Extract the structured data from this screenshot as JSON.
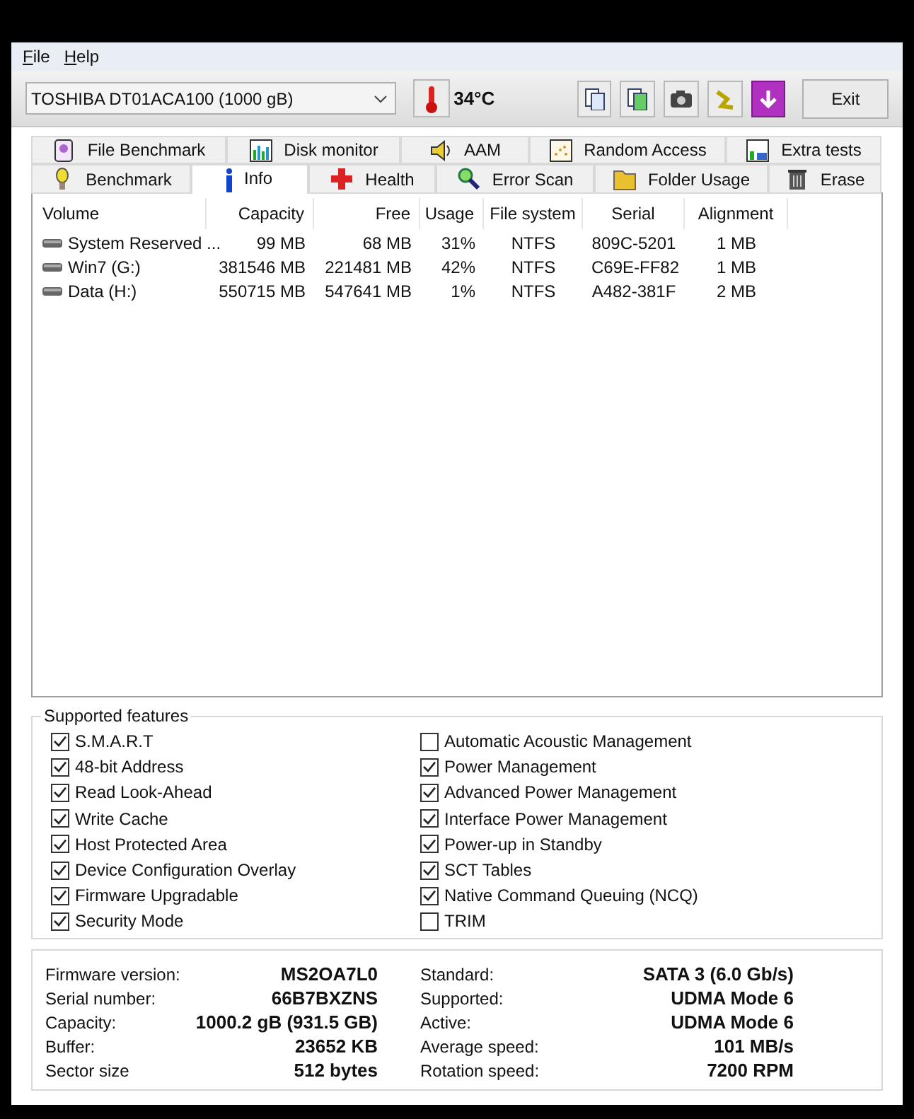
{
  "menu": [
    {
      "label": "File"
    },
    {
      "label": "Help"
    }
  ],
  "toolbar": {
    "drive": "TOSHIBA DT01ACA100 (1000 gB)",
    "temperature": "34°C",
    "exit": "Exit"
  },
  "tabs_top": [
    {
      "label": "File Benchmark",
      "selected": false
    },
    {
      "label": "Disk monitor",
      "selected": false
    },
    {
      "label": "AAM",
      "selected": false
    },
    {
      "label": "Random Access",
      "selected": false
    },
    {
      "label": "Extra tests",
      "selected": false
    }
  ],
  "tabs_bottom": [
    {
      "label": "Benchmark",
      "selected": false
    },
    {
      "label": "Info",
      "selected": true
    },
    {
      "label": "Health",
      "selected": false
    },
    {
      "label": "Error Scan",
      "selected": false
    },
    {
      "label": "Folder Usage",
      "selected": false
    },
    {
      "label": "Erase",
      "selected": false
    }
  ],
  "table": {
    "columns": [
      "Volume",
      "Capacity",
      "Free",
      "Usage",
      "File system",
      "Serial",
      "Alignment"
    ],
    "rows": [
      [
        "System Reserved ...",
        "99 MB",
        "68 MB",
        "31%",
        "NTFS",
        "809C-5201",
        "1 MB"
      ],
      [
        "Win7 (G:)",
        "381546 MB",
        "221481 MB",
        "42%",
        "NTFS",
        "C69E-FF82",
        "1 MB"
      ],
      [
        "Data (H:)",
        "550715 MB",
        "547641 MB",
        "1%",
        "NTFS",
        "A482-381F",
        "2 MB"
      ]
    ]
  },
  "features": {
    "title": "Supported features",
    "items": [
      {
        "label": "S.M.A.R.T",
        "checked": true
      },
      {
        "label": "48-bit Address",
        "checked": true
      },
      {
        "label": "Read Look-Ahead",
        "checked": true
      },
      {
        "label": "Write Cache",
        "checked": true
      },
      {
        "label": "Host Protected Area",
        "checked": true
      },
      {
        "label": "Device Configuration Overlay",
        "checked": true
      },
      {
        "label": "Firmware Upgradable",
        "checked": true
      },
      {
        "label": "Security Mode",
        "checked": true
      },
      {
        "label": "Automatic Acoustic Management",
        "checked": false
      },
      {
        "label": "Power Management",
        "checked": true
      },
      {
        "label": "Advanced Power Management",
        "checked": true
      },
      {
        "label": "Interface Power Management",
        "checked": true
      },
      {
        "label": "Power-up in Standby",
        "checked": true
      },
      {
        "label": "SCT Tables",
        "checked": true
      },
      {
        "label": "Native Command Queuing (NCQ)",
        "checked": true
      },
      {
        "label": "TRIM",
        "checked": false
      }
    ]
  },
  "details": [
    {
      "label": "Firmware version:",
      "value": "MS2OA7L0"
    },
    {
      "label": "Serial number:",
      "value": "66B7BXZNS"
    },
    {
      "label": "Capacity:",
      "value": "1000.2 gB (931.5 GB)"
    },
    {
      "label": "Buffer:",
      "value": "23652 KB"
    },
    {
      "label": "Sector size",
      "value": "512 bytes"
    },
    {
      "label": "Standard:",
      "value": "SATA 3 (6.0 Gb/s)"
    },
    {
      "label": "Supported:",
      "value": "UDMA Mode 6"
    },
    {
      "label": "Active:",
      "value": "UDMA Mode 6"
    },
    {
      "label": "Average speed:",
      "value": "101 MB/s"
    },
    {
      "label": "Rotation speed:",
      "value": "7200 RPM"
    }
  ]
}
